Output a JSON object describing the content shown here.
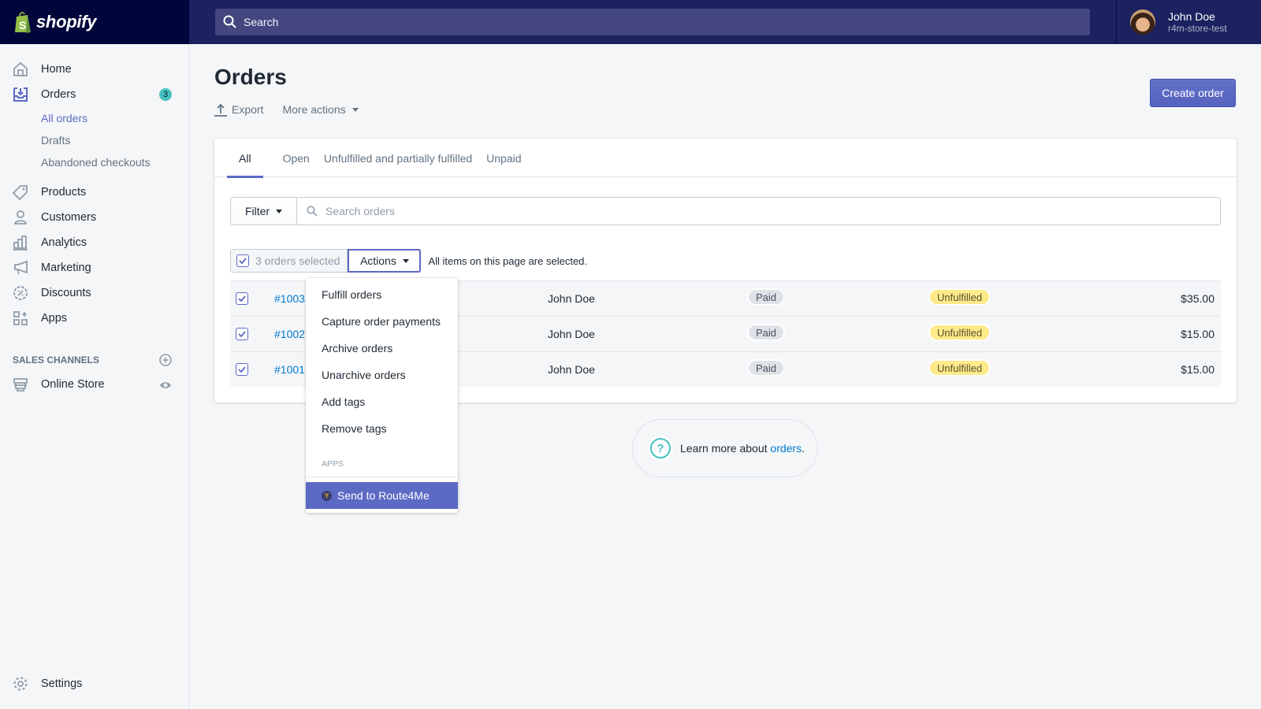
{
  "app": {
    "brand": "shopify"
  },
  "topbar": {
    "search_placeholder": "Search",
    "user": {
      "name": "John Doe",
      "store": "r4m-store-test"
    }
  },
  "sidebar": {
    "items": [
      {
        "label": "Home",
        "icon": "home-icon"
      },
      {
        "label": "Orders",
        "icon": "orders-icon",
        "badge": "3"
      },
      {
        "label": "Products",
        "icon": "tag-icon"
      },
      {
        "label": "Customers",
        "icon": "person-icon"
      },
      {
        "label": "Analytics",
        "icon": "bar-chart-icon"
      },
      {
        "label": "Marketing",
        "icon": "megaphone-icon"
      },
      {
        "label": "Discounts",
        "icon": "discount-icon"
      },
      {
        "label": "Apps",
        "icon": "apps-icon"
      }
    ],
    "orders_sub": [
      {
        "label": "All orders",
        "active": true
      },
      {
        "label": "Drafts"
      },
      {
        "label": "Abandoned checkouts"
      }
    ],
    "sales_channels_title": "SALES CHANNELS",
    "online_store": "Online Store",
    "settings": "Settings"
  },
  "page": {
    "title": "Orders",
    "export_label": "Export",
    "more_actions_label": "More actions",
    "create_order_label": "Create order"
  },
  "tabs": [
    "All",
    "Open",
    "Unfulfilled and partially fulfilled",
    "Unpaid"
  ],
  "filter": {
    "filter_label": "Filter",
    "search_placeholder": "Search orders"
  },
  "bulk": {
    "selected_label": "3 orders selected",
    "actions_label": "Actions",
    "message": "All items on this page are selected."
  },
  "orders": [
    {
      "number": "#1003",
      "customer": "John Doe",
      "payment": "Paid",
      "fulfillment": "Unfulfilled",
      "total": "$35.00",
      "checked": true
    },
    {
      "number": "#1002",
      "customer": "John Doe",
      "payment": "Paid",
      "fulfillment": "Unfulfilled",
      "total": "$15.00",
      "checked": true
    },
    {
      "number": "#1001",
      "customer": "John Doe",
      "payment": "Paid",
      "fulfillment": "Unfulfilled",
      "total": "$15.00",
      "checked": true
    }
  ],
  "actions_menu": {
    "items": [
      "Fulfill orders",
      "Capture order payments",
      "Archive orders",
      "Unarchive orders",
      "Add tags",
      "Remove tags"
    ],
    "apps_section": "APPS",
    "app_action": "Send to Route4Me"
  },
  "learn_more": {
    "prefix": "Learn more about ",
    "link": "orders",
    "suffix": "."
  },
  "colors": {
    "brand_dark": "#000639",
    "topbar": "#1c2260",
    "accent": "#5c6ac4",
    "teal": "#47c1bf",
    "link": "#007ace",
    "unfulfilled": "#ffea8a"
  }
}
